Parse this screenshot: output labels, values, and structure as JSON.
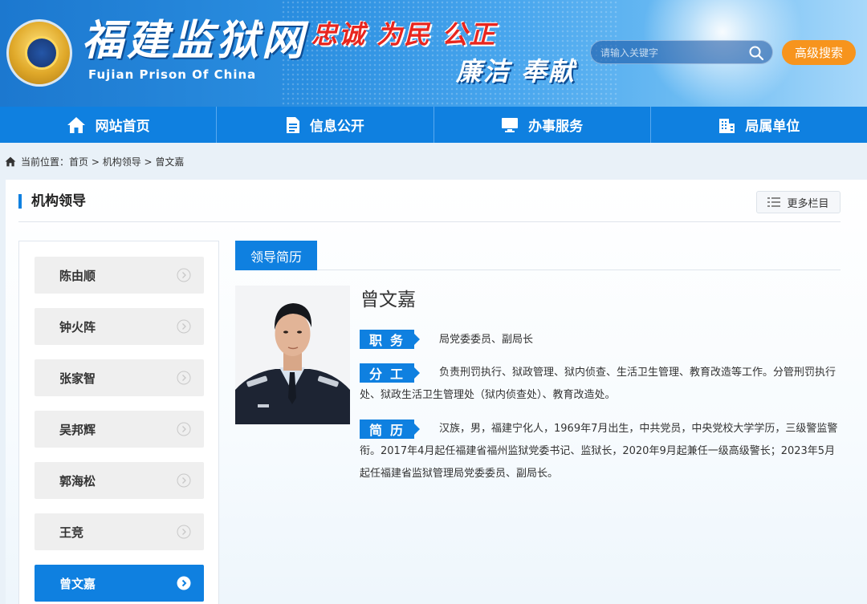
{
  "header": {
    "site_title": "福建监狱网",
    "site_subtitle": "Fujian Prison Of China",
    "slogan_line1": "忠诚 为民 公正",
    "slogan_line2": "廉洁 奉献",
    "search_placeholder": "请输入关键字",
    "advanced_search_label": "高级搜索"
  },
  "nav": {
    "items": [
      {
        "label": "网站首页",
        "icon": "home-icon"
      },
      {
        "label": "信息公开",
        "icon": "document-icon"
      },
      {
        "label": "办事服务",
        "icon": "monitor-icon"
      },
      {
        "label": "局属单位",
        "icon": "building-icon"
      }
    ]
  },
  "breadcrumb": {
    "prefix": "当前位置：",
    "path": "首页 > 机构领导 > 曾文嘉"
  },
  "section": {
    "title": "机构领导",
    "more_label": "更多栏目"
  },
  "sidebar": {
    "items": [
      {
        "label": "陈由顺"
      },
      {
        "label": "钟火阵"
      },
      {
        "label": "张家智"
      },
      {
        "label": "吴邦辉"
      },
      {
        "label": "郭海松"
      },
      {
        "label": "王竞"
      },
      {
        "label": "曾文嘉",
        "active": true
      }
    ]
  },
  "profile": {
    "tab_label": "领导简历",
    "name": "曾文嘉",
    "position_label": "职务",
    "position": "局党委委员、副局长",
    "duty_label": "分工",
    "duty": "负责刑罚执行、狱政管理、狱内侦查、生活卫生管理、教育改造等工作。分管刑罚执行处、狱政生活卫生管理处（狱内侦查处）、教育改造处。",
    "bio_label": "简历",
    "bio": "汉族，男，福建宁化人，1969年7月出生，中共党员，中央党校大学学历，三级警监警衔。2017年4月起任福建省福州监狱党委书记、监狱长，2020年9月起兼任一级高级警长；2023年5月起任福建省监狱管理局党委委员、副局长。"
  },
  "colors": {
    "primary": "#0f80e0",
    "accent": "#f7941d",
    "slogan_red": "#e8261f"
  }
}
